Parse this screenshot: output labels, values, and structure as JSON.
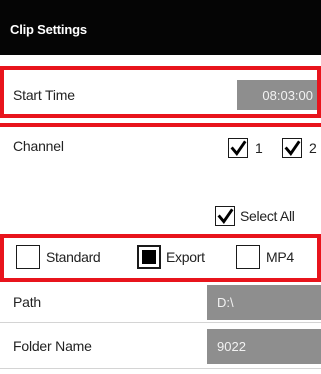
{
  "title": "Clip Settings",
  "start_time": {
    "label": "Start Time",
    "value": "08:03:00"
  },
  "channel": {
    "label": "Channel",
    "options": [
      {
        "label": "1",
        "checked": true
      },
      {
        "label": "2",
        "checked": true
      }
    ],
    "select_all": {
      "label": "Select All",
      "checked": true
    }
  },
  "mode": {
    "options": [
      {
        "label": "Standard",
        "selected": false
      },
      {
        "label": "Export",
        "selected": true
      },
      {
        "label": "MP4",
        "selected": false
      }
    ]
  },
  "path": {
    "label": "Path",
    "value": "D:\\"
  },
  "folder_name": {
    "label": "Folder Name",
    "value": "9022"
  }
}
